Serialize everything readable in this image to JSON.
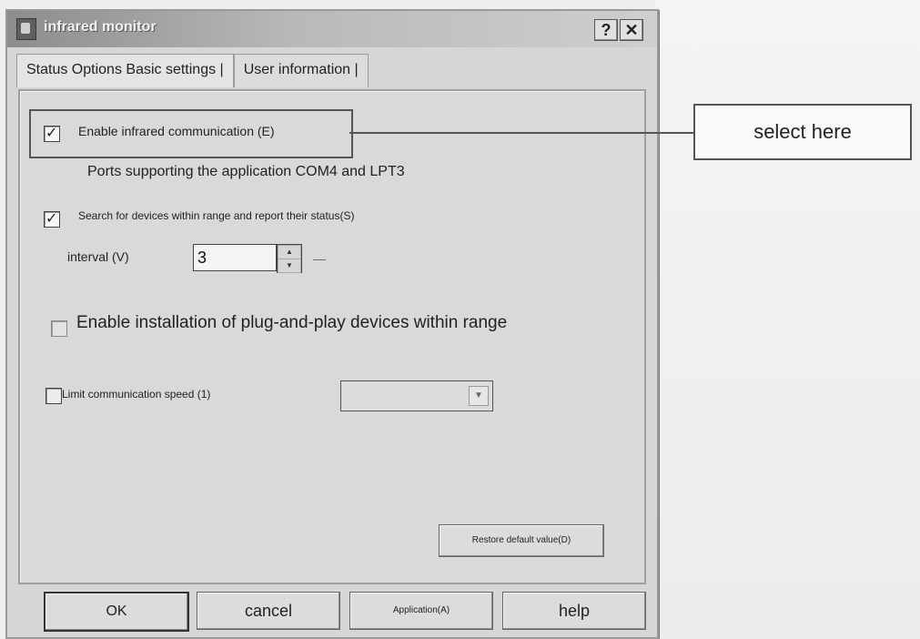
{
  "window": {
    "title": "infrared monitor",
    "help_glyph": "?",
    "close_glyph": "✕"
  },
  "tabs": [
    {
      "label": "Status Options Basic settings |"
    },
    {
      "label": "User information |"
    }
  ],
  "panel": {
    "enable_ir_label": "Enable infrared communication (E)",
    "enable_ir_checked": true,
    "ports_text": "Ports supporting the application COM4 and LPT3",
    "search_label": "Search for devices within range and report their status(S)",
    "search_checked": true,
    "interval_label": "interval (V)",
    "interval_value": "3",
    "interval_suffix": "—",
    "pnp_label": "Enable installation of plug-and-play devices within range",
    "limit_speed_label": "Limit communication speed (1)",
    "restore_label": "Restore default value(D)"
  },
  "buttons": {
    "ok": "OK",
    "cancel": "cancel",
    "apply": "Application(A)",
    "help": "help"
  },
  "callout": {
    "text": "select here"
  }
}
